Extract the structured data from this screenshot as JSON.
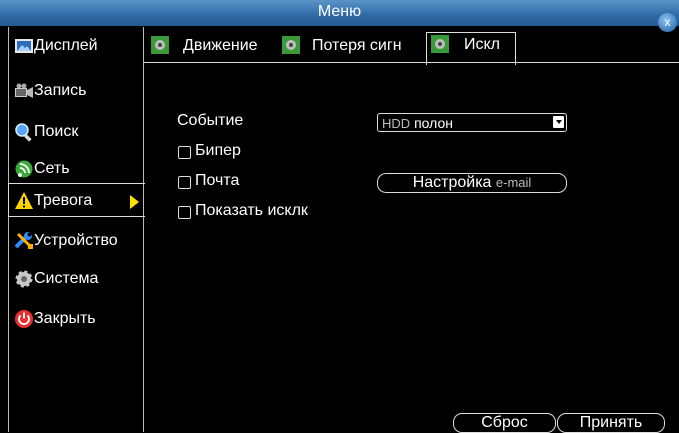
{
  "window": {
    "title": "Меню",
    "close_label": "x"
  },
  "sidebar": {
    "items": [
      {
        "label": "Дисплей"
      },
      {
        "label": "Запись"
      },
      {
        "label": "Поиск"
      },
      {
        "label": "Сеть"
      },
      {
        "label": "Тревога",
        "active": true
      },
      {
        "label": "Устройство"
      },
      {
        "label": "Система"
      },
      {
        "label": "Закрыть"
      }
    ]
  },
  "tabs": [
    {
      "label": "Движение"
    },
    {
      "label": "Потеря сигн"
    },
    {
      "label": "Искл",
      "active": true
    }
  ],
  "form": {
    "event_label": "Событие",
    "event_value_prefix": "HDD",
    "event_value_suffix": "полон",
    "beeper_label": "Бипер",
    "mail_label": "Почта",
    "show_exception_label": "Показать исклк",
    "email_setup_prefix": "Настройка",
    "email_setup_suffix": "e-mail"
  },
  "footer": {
    "reset_label": "Сброс",
    "apply_label": "Принять"
  },
  "colors": {
    "titlebar": "#2f6aa6",
    "background": "#000000",
    "active_arrow": "#ffe000"
  }
}
